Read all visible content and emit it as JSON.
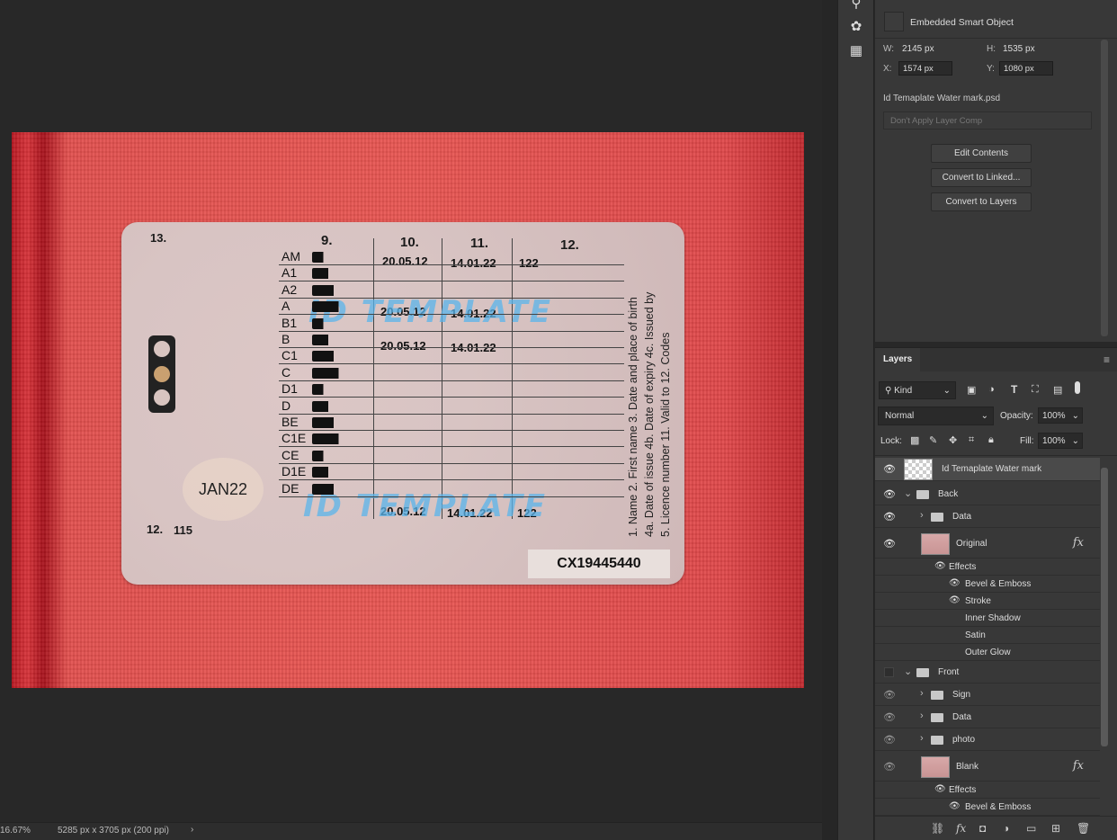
{
  "status": {
    "zoom": "16.67%",
    "doc_info": "5285 px x 3705 px (200 ppi)",
    "arrow": "›"
  },
  "card": {
    "field13": "13.",
    "col9": "9.",
    "col10": "10.",
    "col11": "11.",
    "col12": "12.",
    "categories": [
      "AM",
      "A1",
      "A2",
      "A",
      "B1",
      "B",
      "C1",
      "C",
      "D1",
      "D",
      "BE",
      "C1E",
      "CE",
      "D1E",
      "DE"
    ],
    "row_am": {
      "d10": "20.05.12",
      "d11": "14.01.22",
      "d12": "122"
    },
    "row_a": {
      "d10": "20.05.12",
      "d11": "14.01.22"
    },
    "row_b": {
      "d10": "20.05.12",
      "d11": "14.01.22"
    },
    "row_de": {
      "d10": "20.05.12",
      "d11": "14.01.22",
      "d12": "122"
    },
    "watermark": "ID TEMPLATE",
    "jan": "JAN22",
    "field12": "12.",
    "field12_val": "115",
    "serial": "CX19445440",
    "side_lines": [
      "1. Name  2. First name  3. Date and place of birth",
      "4a. Date of issue  4b. Date of expiry  4c. Issued by",
      "5. Licence number  11. Valid to  12. Codes"
    ]
  },
  "properties": {
    "type": "Embedded Smart Object",
    "w_label": "W:",
    "w_val": "2145 px",
    "h_label": "H:",
    "h_val": "1535 px",
    "x_label": "X:",
    "x_val": "1574 px",
    "y_label": "Y:",
    "y_val": "1080 px",
    "filename": "Id Temaplate Water mark.psd",
    "layer_comp": "Don't Apply Layer Comp",
    "btn_edit": "Edit Contents",
    "btn_linked": "Convert to Linked...",
    "btn_layers": "Convert to Layers"
  },
  "layers": {
    "tab": "Layers",
    "kind": "Kind",
    "blend": "Normal",
    "opacity_label": "Opacity:",
    "opacity": "100%",
    "lock_label": "Lock:",
    "fill_label": "Fill:",
    "fill": "100%",
    "items": {
      "watermark": "Id Temaplate Water mark",
      "back": "Back",
      "data1": "Data",
      "original": "Original",
      "effects1": "Effects",
      "bevel1": "Bevel & Emboss",
      "stroke": "Stroke",
      "inner_shadow": "Inner Shadow",
      "satin": "Satin",
      "outer_glow": "Outer Glow",
      "front": "Front",
      "sign": "Sign",
      "data2": "Data",
      "photo": "photo",
      "blank": "Blank",
      "effects2": "Effects",
      "bevel2": "Bevel & Emboss"
    },
    "fx": "fx"
  }
}
